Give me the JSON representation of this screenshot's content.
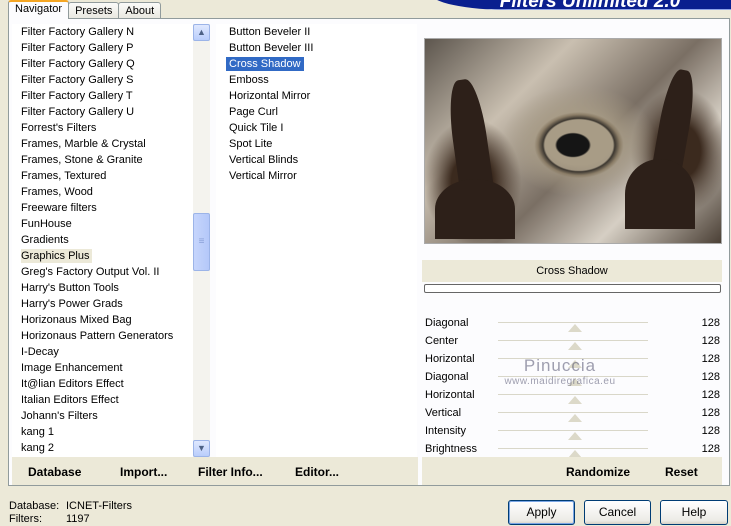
{
  "tabs": [
    {
      "label": "Navigator",
      "active": true
    },
    {
      "label": "Presets",
      "active": false
    },
    {
      "label": "About",
      "active": false
    }
  ],
  "banner": {
    "title": "Filters Unlimited 2.0"
  },
  "categories": [
    "Filter Factory Gallery N",
    "Filter Factory Gallery P",
    "Filter Factory Gallery Q",
    "Filter Factory Gallery S",
    "Filter Factory Gallery T",
    "Filter Factory Gallery U",
    "Forrest's Filters",
    "Frames, Marble & Crystal",
    "Frames, Stone & Granite",
    "Frames, Textured",
    "Frames, Wood",
    "Freeware filters",
    "FunHouse",
    "Gradients",
    "Graphics Plus",
    "Greg's Factory Output Vol. II",
    "Harry's Button Tools",
    "Harry's Power Grads",
    "Horizonaus Mixed Bag",
    "Horizonaus Pattern Generators",
    "I-Decay",
    "Image Enhancement",
    "It@lian Editors Effect",
    "Italian Editors Effect",
    "Johann's Filters",
    "kang 1",
    "kang 2"
  ],
  "selected_category": "Graphics Plus",
  "filters": [
    "Button Beveler II",
    "Button Beveler III",
    "Cross Shadow",
    "Emboss",
    "Horizontal Mirror",
    "Page Curl",
    "Quick Tile I",
    "Spot Lite",
    "Vertical Blinds",
    "Vertical Mirror"
  ],
  "selected_filter": "Cross Shadow",
  "preview": {
    "title": "Cross Shadow",
    "progress": 0
  },
  "watermark": {
    "name": "Pinuccia",
    "site": "www.maidiregrafica.eu"
  },
  "params": [
    {
      "label": "Diagonal",
      "value": "128"
    },
    {
      "label": "Center",
      "value": "128"
    },
    {
      "label": "Horizontal",
      "value": "128"
    },
    {
      "label": "Diagonal",
      "value": "128"
    },
    {
      "label": "Horizontal",
      "value": "128"
    },
    {
      "label": "Vertical",
      "value": "128"
    },
    {
      "label": "Intensity",
      "value": "128"
    },
    {
      "label": "Brightness",
      "value": "128"
    }
  ],
  "links": {
    "database": "Database",
    "import": "Import...",
    "filter_info": "Filter Info...",
    "editor": "Editor...",
    "randomize": "Randomize",
    "reset": "Reset"
  },
  "footer": {
    "database_label": "Database:",
    "database_value": "ICNET-Filters",
    "filters_label": "Filters:",
    "filters_value": "1197"
  },
  "buttons": {
    "apply": "Apply",
    "cancel": "Cancel",
    "help": "Help"
  },
  "colors": {
    "selection": "#316ac5",
    "banner": "#0a1f8f",
    "window": "#ece9d8"
  }
}
